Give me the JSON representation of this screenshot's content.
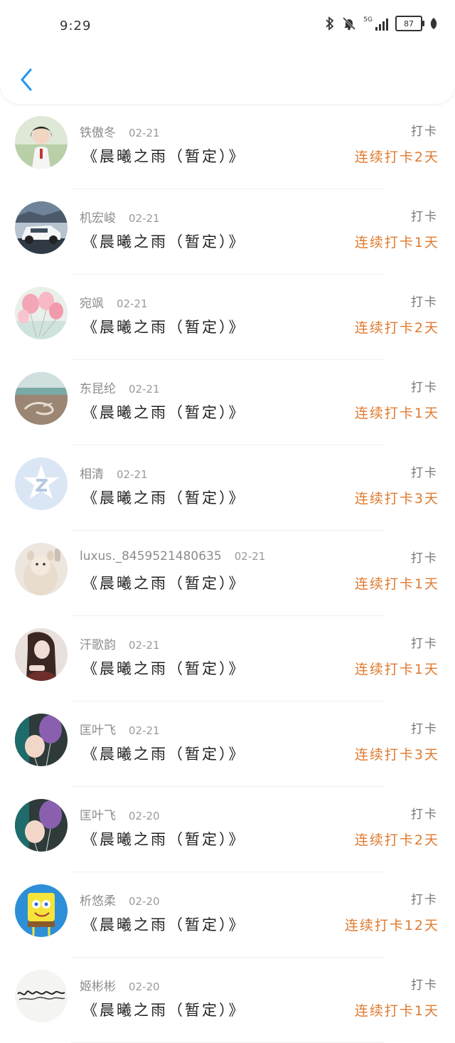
{
  "status_bar": {
    "time": "9:29",
    "network": "5G",
    "battery": "87"
  },
  "header": {
    "back_icon": "chevron-left-icon"
  },
  "accent_color": "#2196f3",
  "streak_color": "#e07a2f",
  "items": [
    {
      "name": "铁傲冬",
      "date": "02-21",
      "title": "《晨曦之雨（暂定）》",
      "action": "打卡",
      "streak": "连续打卡2天",
      "avatar": "photo-girl"
    },
    {
      "name": "机宏峻",
      "date": "02-21",
      "title": "《晨曦之雨（暂定）》",
      "action": "打卡",
      "streak": "连续打卡1天",
      "avatar": "photo-car"
    },
    {
      "name": "宛飒",
      "date": "02-21",
      "title": "《晨曦之雨（暂定）》",
      "action": "打卡",
      "streak": "连续打卡2天",
      "avatar": "photo-balloons-pink"
    },
    {
      "name": "东昆纶",
      "date": "02-21",
      "title": "《晨曦之雨（暂定）》",
      "action": "打卡",
      "streak": "连续打卡1天",
      "avatar": "photo-beach"
    },
    {
      "name": "相清",
      "date": "02-21",
      "title": "《晨曦之雨（暂定）》",
      "action": "打卡",
      "streak": "连续打卡3天",
      "avatar": "qzone-default"
    },
    {
      "name": "luxus._8459521480635",
      "date": "02-21",
      "title": "《晨曦之雨（暂定）》",
      "action": "打卡",
      "streak": "连续打卡1天",
      "avatar": "photo-plush"
    },
    {
      "name": "汗歌韵",
      "date": "02-21",
      "title": "《晨曦之雨（暂定）》",
      "action": "打卡",
      "streak": "连续打卡1天",
      "avatar": "photo-woman"
    },
    {
      "name": "匡叶飞",
      "date": "02-21",
      "title": "《晨曦之雨（暂定）》",
      "action": "打卡",
      "streak": "连续打卡3天",
      "avatar": "photo-balloons"
    },
    {
      "name": "匡叶飞",
      "date": "02-20",
      "title": "《晨曦之雨（暂定）》",
      "action": "打卡",
      "streak": "连续打卡2天",
      "avatar": "photo-balloons"
    },
    {
      "name": "析悠柔",
      "date": "02-20",
      "title": "《晨曦之雨（暂定）》",
      "action": "打卡",
      "streak": "连续打卡12天",
      "avatar": "cartoon-sponge"
    },
    {
      "name": "姬彬彬",
      "date": "02-20",
      "title": "《晨曦之雨（暂定）》",
      "action": "打卡",
      "streak": "连续打卡1天",
      "avatar": "handwriting"
    }
  ]
}
